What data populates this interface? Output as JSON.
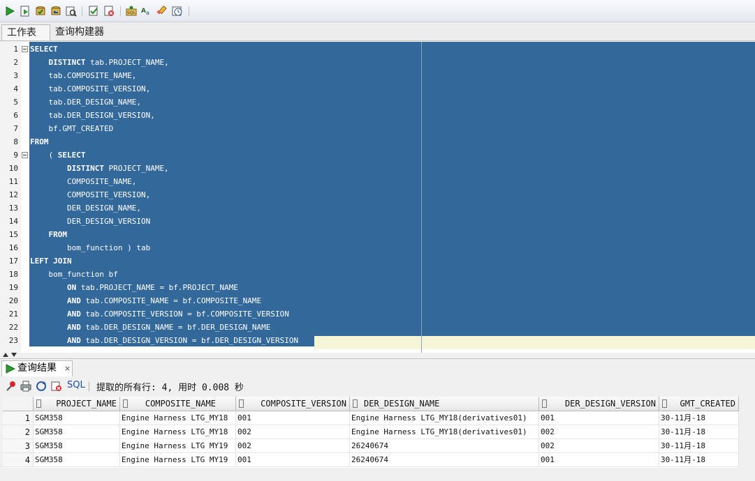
{
  "toolbar": {
    "icons": [
      "run-statement-icon",
      "run-script-icon",
      "commit-icon",
      "rollback-icon",
      "explain-plan-icon",
      "autotrace-icon",
      "sql-tuning-icon",
      "unshared-sql-icon",
      "to-upper-icon",
      "clear-icon",
      "history-icon"
    ]
  },
  "tabs": {
    "worksheet": "工作表",
    "query_builder": "查询构建器"
  },
  "editor": {
    "lines": [
      {
        "num": "1",
        "kw": "SELECT",
        "rest": "",
        "indent": ""
      },
      {
        "num": "2",
        "kw": "DISTINCT",
        "rest": " tab.PROJECT_NAME,",
        "indent": "    "
      },
      {
        "num": "3",
        "kw": "",
        "rest": "tab.COMPOSITE_NAME,",
        "indent": "    "
      },
      {
        "num": "4",
        "kw": "",
        "rest": "tab.COMPOSITE_VERSION,",
        "indent": "    "
      },
      {
        "num": "5",
        "kw": "",
        "rest": "tab.DER_DESIGN_NAME,",
        "indent": "    "
      },
      {
        "num": "6",
        "kw": "",
        "rest": "tab.DER_DESIGN_VERSION,",
        "indent": "    "
      },
      {
        "num": "7",
        "kw": "",
        "rest": "bf.GMT_CREATED",
        "indent": "    "
      },
      {
        "num": "8",
        "kw": "FROM",
        "rest": "",
        "indent": ""
      },
      {
        "num": "9",
        "kw": "",
        "rest": "( ",
        "kw2": "SELECT",
        "indent": "    "
      },
      {
        "num": "10",
        "kw": "DISTINCT",
        "rest": " PROJECT_NAME,",
        "indent": "        "
      },
      {
        "num": "11",
        "kw": "",
        "rest": "COMPOSITE_NAME,",
        "indent": "        "
      },
      {
        "num": "12",
        "kw": "",
        "rest": "COMPOSITE_VERSION,",
        "indent": "        "
      },
      {
        "num": "13",
        "kw": "",
        "rest": "DER_DESIGN_NAME,",
        "indent": "        "
      },
      {
        "num": "14",
        "kw": "",
        "rest": "DER_DESIGN_VERSION",
        "indent": "        "
      },
      {
        "num": "15",
        "kw": "FROM",
        "rest": "",
        "indent": "    "
      },
      {
        "num": "16",
        "kw": "",
        "rest": "bom_function ) tab",
        "indent": "        "
      },
      {
        "num": "17",
        "kw": "LEFT JOIN",
        "rest": "",
        "indent": ""
      },
      {
        "num": "18",
        "kw": "",
        "rest": "bom_function bf",
        "indent": "    "
      },
      {
        "num": "19",
        "kw": "ON",
        "rest": " tab.PROJECT_NAME = bf.PROJECT_NAME",
        "indent": "        "
      },
      {
        "num": "20",
        "kw": "AND",
        "rest": " tab.COMPOSITE_NAME = bf.COMPOSITE_NAME",
        "indent": "        "
      },
      {
        "num": "21",
        "kw": "AND",
        "rest": " tab.COMPOSITE_VERSION = bf.COMPOSITE_VERSION",
        "indent": "        "
      },
      {
        "num": "22",
        "kw": "AND",
        "rest": " tab.DER_DESIGN_NAME = bf.DER_DESIGN_NAME",
        "indent": "        "
      },
      {
        "num": "23",
        "kw": "AND",
        "rest": " tab.DER_DESIGN_VERSION = bf.DER_DESIGN_VERSION",
        "indent": "        "
      }
    ]
  },
  "results": {
    "tab_label": "查询结果",
    "tab_close": "×",
    "sql_label": "SQL",
    "status": "提取的所有行: 4, 用时 0.008 秒",
    "columns": [
      "PROJECT_NAME",
      "COMPOSITE_NAME",
      "COMPOSITE_VERSION",
      "DER_DESIGN_NAME",
      "DER_DESIGN_VERSION",
      "GMT_CREATED"
    ],
    "rows": [
      [
        "1",
        "SGM358",
        "Engine Harness LTG_MY18",
        "001",
        "Engine Harness LTG_MY18(derivatives01)",
        "001",
        "30-11月-18"
      ],
      [
        "2",
        "SGM358",
        "Engine Harness LTG_MY18",
        "002",
        "Engine Harness LTG_MY18(derivatives01)",
        "002",
        "30-11月-18"
      ],
      [
        "3",
        "SGM358",
        "Engine Harness LTG MY19",
        "002",
        "26240674",
        "002",
        "30-11月-18"
      ],
      [
        "4",
        "SGM358",
        "Engine Harness LTG MY19",
        "001",
        "26240674",
        "001",
        "30-11月-18"
      ]
    ]
  }
}
